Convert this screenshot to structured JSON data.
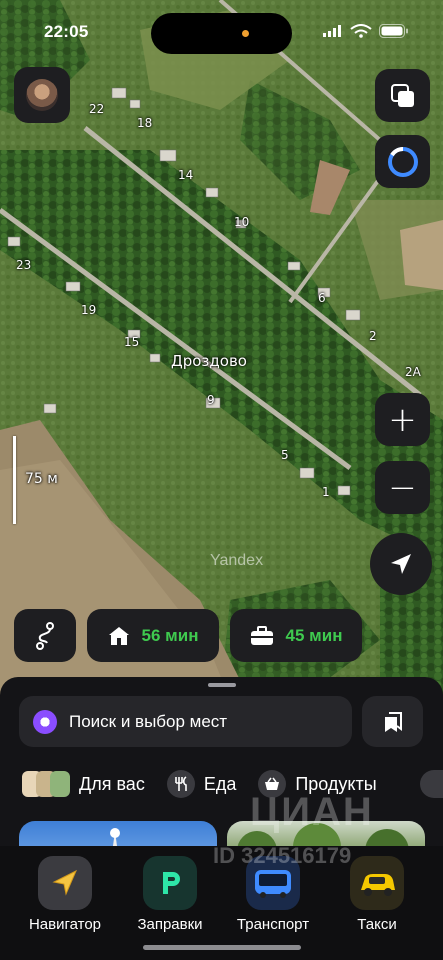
{
  "status_bar": {
    "time": "22:05"
  },
  "map": {
    "village_name": "Дроздово",
    "scale_label": "75 м",
    "watermark": "Yandex",
    "house_numbers": [
      {
        "id": "22",
        "label": "22"
      },
      {
        "id": "18",
        "label": "18"
      },
      {
        "id": "14",
        "label": "14"
      },
      {
        "id": "10",
        "label": "10"
      },
      {
        "id": "6",
        "label": "6"
      },
      {
        "id": "2",
        "label": "2"
      },
      {
        "id": "2a",
        "label": "2А"
      },
      {
        "id": "23",
        "label": "23"
      },
      {
        "id": "19",
        "label": "19"
      },
      {
        "id": "15",
        "label": "15"
      },
      {
        "id": "9",
        "label": "9"
      },
      {
        "id": "5",
        "label": "5"
      },
      {
        "id": "1",
        "label": "1"
      }
    ]
  },
  "controls": {
    "zoom_in": "+",
    "zoom_out": "−"
  },
  "route_chips": {
    "home_time": "56 мин",
    "work_time": "45 мин"
  },
  "search": {
    "placeholder": "Поиск и выбор мест"
  },
  "categories": [
    {
      "label": "Для вас",
      "icon": "for-you-icon"
    },
    {
      "label": "Еда",
      "icon": "food-icon"
    },
    {
      "label": "Продукты",
      "icon": "grocery-icon"
    }
  ],
  "tabs": [
    {
      "label": "Навигатор",
      "icon": "navigator-icon"
    },
    {
      "label": "Заправки",
      "icon": "gas-station-icon"
    },
    {
      "label": "Транспорт",
      "icon": "transport-icon"
    },
    {
      "label": "Такси",
      "icon": "taxi-icon"
    }
  ],
  "overlay_watermark": {
    "brand": "ЦИАН",
    "id_text": "ID 324516179"
  },
  "colors": {
    "accent_green": "#3fca4f",
    "panel": "#1e1e21",
    "alice_purple": "#8a4dff"
  }
}
